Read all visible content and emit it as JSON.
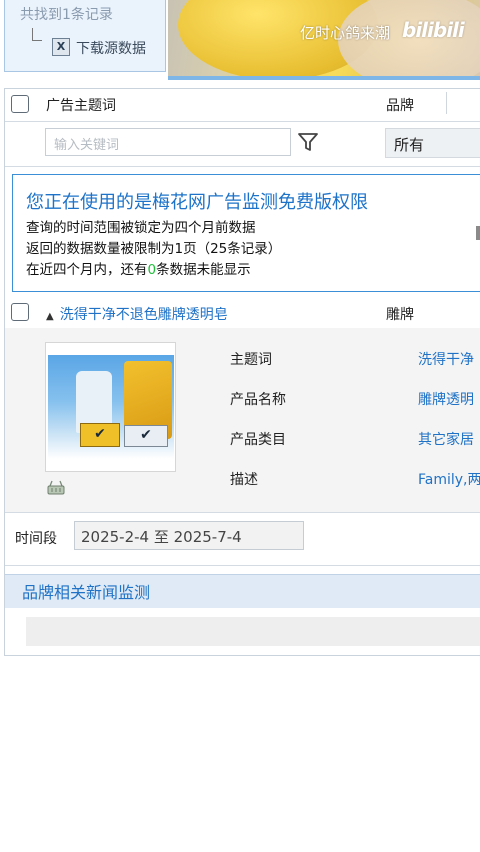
{
  "top": {
    "found_text": "共找到1条记录",
    "download_label": "下载源数据",
    "excel_icon": "excel-icon"
  },
  "video": {
    "watermark": "亿时心鸽来潮",
    "brand_logo": "bilibili"
  },
  "table_header": {
    "keyword_col": "广告主题词",
    "brand_col": "品牌",
    "keyword_placeholder": "输入关键词",
    "brand_selected": "所有"
  },
  "notice": {
    "title": "您正在使用的是梅花网广告监测免费版权限",
    "line1": "查询的时间范围被锁定为四个月前数据",
    "line2": "返回的数据数量被限制为1页（25条记录）",
    "line3_prefix": "在近四个月内，还有",
    "line3_count": "0",
    "line3_suffix": "条数据未能显示"
  },
  "result": {
    "title": "洗得干净不退色雕牌透明皂",
    "brand": "雕牌",
    "fields": [
      {
        "label": "主题词",
        "value": "洗得干净"
      },
      {
        "label": "产品名称",
        "value": "雕牌透明"
      },
      {
        "label": "产品类目",
        "value": "其它家居"
      },
      {
        "label": "描述",
        "value": "Family,两"
      }
    ]
  },
  "time": {
    "label": "时间段",
    "range": "2025-2-4 至 2025-7-4"
  },
  "news": {
    "title": "品牌相关新闻监测"
  },
  "colors": {
    "link_blue": "#1f72c6",
    "notice_border": "#3b8fd6",
    "green_count": "#1fbf3a",
    "header_bg": "#dfeaf6"
  }
}
